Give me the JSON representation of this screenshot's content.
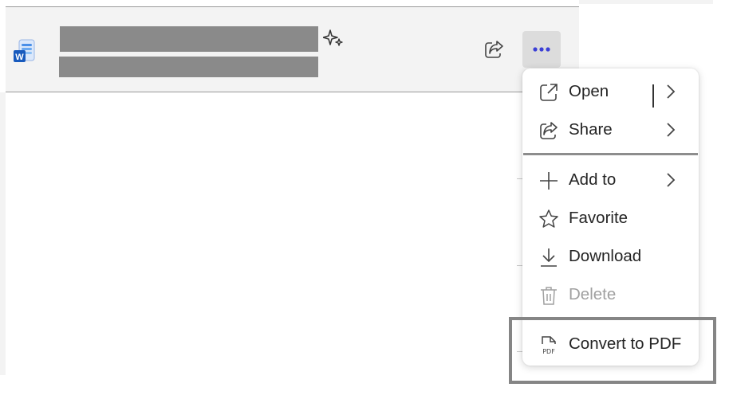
{
  "file_row": {
    "file_icon": "word-document-icon",
    "ai_icon": "sparkle-icon",
    "share_icon": "share-icon",
    "more_label": "•••",
    "more_icon": "more-options-icon"
  },
  "context_menu": {
    "items": [
      {
        "label": "Open",
        "icon": "open-external-icon",
        "has_submenu": true,
        "disabled": false
      },
      {
        "label": "Share",
        "icon": "share-icon",
        "has_submenu": true,
        "disabled": false
      },
      {
        "label": "Add to",
        "icon": "plus-icon",
        "has_submenu": true,
        "disabled": false
      },
      {
        "label": "Favorite",
        "icon": "star-icon",
        "has_submenu": false,
        "disabled": false
      },
      {
        "label": "Download",
        "icon": "download-icon",
        "has_submenu": false,
        "disabled": false
      },
      {
        "label": "Delete",
        "icon": "trash-icon",
        "has_submenu": false,
        "disabled": true
      },
      {
        "label": "Convert to PDF",
        "icon": "pdf-file-icon",
        "has_submenu": false,
        "disabled": false
      }
    ]
  },
  "colors": {
    "accent": "#3b3fd6",
    "row_bg": "#f3f3f3",
    "disabled_text": "#a0a0a0",
    "highlight_border": "#858585"
  }
}
